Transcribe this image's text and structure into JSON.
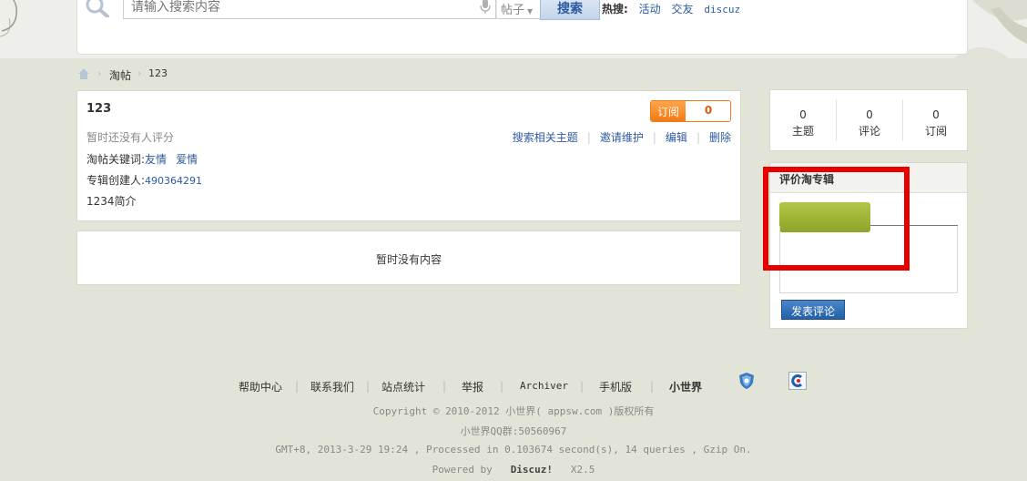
{
  "header": {
    "search_placeholder": "请输入搜索内容",
    "search_type": "帖子",
    "search_button": "搜索",
    "hot_label": "热搜:",
    "hot_items": [
      "活动",
      "交友",
      "discuz"
    ]
  },
  "breadcrumb": {
    "items": [
      "淘帖",
      "123"
    ]
  },
  "collection": {
    "title": "123",
    "subscribe_label": "订阅",
    "subscribe_count": "0",
    "rating_text": "暂时还没有人评分",
    "actions": [
      "搜索相关主题",
      "邀请维护",
      "编辑",
      "删除"
    ],
    "keywords_label": "淘帖关键词:",
    "keywords": [
      "友情",
      "爱情"
    ],
    "creator_label": "专辑创建人:",
    "creator": "490364291",
    "intro": "1234简介"
  },
  "content": {
    "empty_message": "暂时没有内容"
  },
  "stats": [
    {
      "value": "0",
      "label": "主题"
    },
    {
      "value": "0",
      "label": "评论"
    },
    {
      "value": "0",
      "label": "订阅"
    }
  ],
  "rating_panel": {
    "title": "评价淘专辑",
    "post_button": "发表评论"
  },
  "footer": {
    "links": [
      "帮助中心",
      "联系我们",
      "站点统计",
      "举报",
      "Archiver",
      "手机版",
      "小世界"
    ],
    "copyright": "Copyright © 2010-2012 小世界( appsw.com )版权所有",
    "qq_group": "小世界QQ群:50560967",
    "perf": "GMT+8, 2013-3-29 19:24 , Processed in 0.103674 second(s), 14 queries , Gzip On.",
    "powered_prefix": "Powered by",
    "powered_brand": "Discuz!",
    "powered_version": "X2.5"
  },
  "colors": {
    "accent_orange": "#f27a12",
    "link_blue": "#2c5aa0",
    "highlight_red": "#e60000",
    "rating_green": "#9bb236"
  }
}
